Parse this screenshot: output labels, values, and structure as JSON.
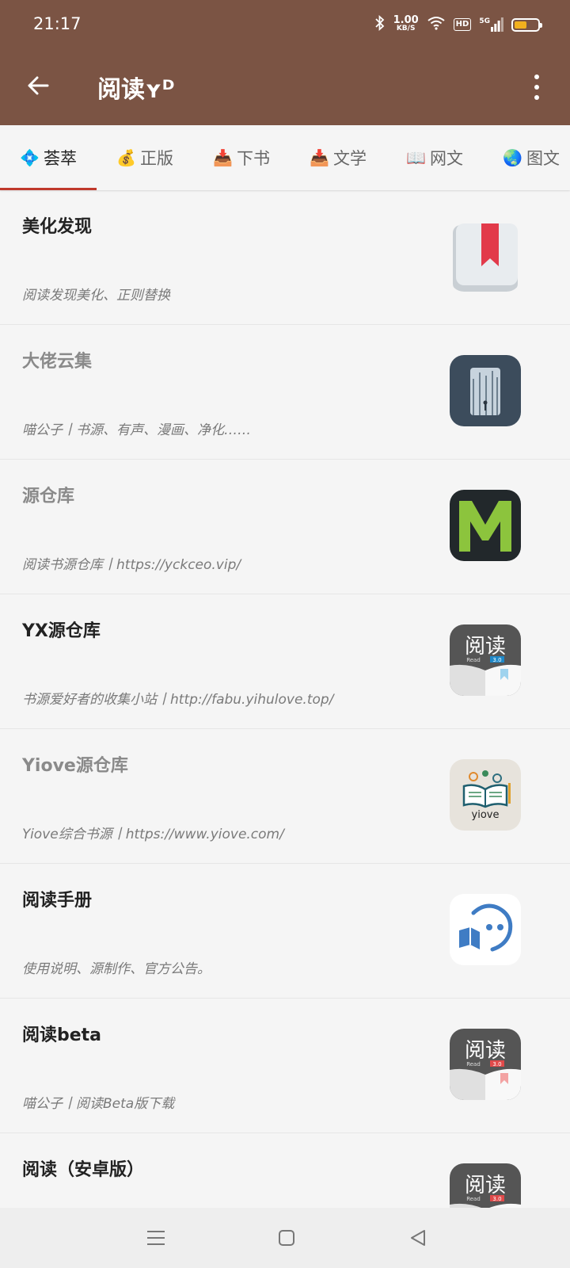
{
  "status_bar": {
    "time": "21:17",
    "speed_value": "1.00",
    "speed_unit": "KB/S",
    "hd_label": "HD",
    "network_label": "5G",
    "battery_level": 0.55
  },
  "app_bar": {
    "title": "阅读ʏᴰ",
    "bg_color": "#7b5444"
  },
  "tabs": [
    {
      "icon": "diamond-icon",
      "emoji": "💠",
      "label": "荟萃",
      "active": true
    },
    {
      "icon": "money-bag-icon",
      "emoji": "💰",
      "label": "正版",
      "active": false
    },
    {
      "icon": "inbox-tray-icon",
      "emoji": "📥",
      "label": "下书",
      "active": false
    },
    {
      "icon": "inbox-tray-icon",
      "emoji": "📥",
      "label": "文学",
      "active": false
    },
    {
      "icon": "open-book-icon",
      "emoji": "📖",
      "label": "网文",
      "active": false
    },
    {
      "icon": "globe-icon",
      "emoji": "🌏",
      "label": "图文",
      "active": false
    }
  ],
  "items": [
    {
      "title": "美化发现",
      "desc": "阅读发现美化、正则替换",
      "icon": "bookmark-book-icon"
    },
    {
      "title": "大佬云集",
      "desc": "喵公子丨书源、有声、漫画、净化……",
      "icon": "forest-photo-icon"
    },
    {
      "title": "源仓库",
      "desc": "阅读书源仓库丨https://yckceo.vip/",
      "icon": "green-m-logo-icon"
    },
    {
      "title": "YX源仓库",
      "desc": "书源爱好者的收集小站丨http://fabu.yihulove.top/",
      "icon": "read-app-icon",
      "logo_text": "阅读",
      "logo_sub": "Read",
      "logo_ver": "3.0"
    },
    {
      "title": "Yiove源仓库",
      "desc": "Yiove综合书源丨https://www.yiove.com/",
      "icon": "yiove-logo-icon",
      "logo_text": "yiove"
    },
    {
      "title": "阅读手册",
      "desc": "使用说明、源制作、官方公告。",
      "icon": "chat-book-icon"
    },
    {
      "title": "阅读beta",
      "desc": "喵公子丨阅读Beta版下载",
      "icon": "read-app-icon",
      "logo_text": "阅读",
      "logo_sub": "Read",
      "logo_ver": "3.0"
    },
    {
      "title": "阅读（安卓版）",
      "desc": "",
      "icon": "read-app-icon",
      "logo_text": "阅读",
      "logo_sub": "Read",
      "logo_ver": "3.0"
    }
  ]
}
